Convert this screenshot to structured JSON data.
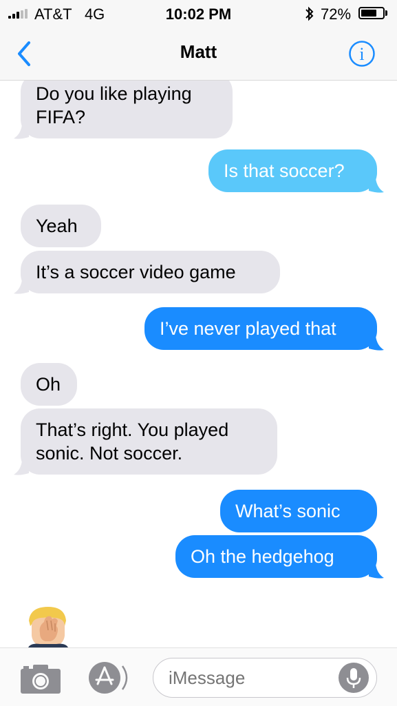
{
  "status_bar": {
    "carrier": "AT&T",
    "network": "4G",
    "time": "10:02 PM",
    "battery_percent": "72%",
    "battery_level": 0.72,
    "signal_bars_filled": 3,
    "signal_bars_total": 5,
    "icons": [
      "signal-icon",
      "bluetooth-icon",
      "battery-icon"
    ]
  },
  "nav": {
    "title": "Matt",
    "back_icon": "chevron-left-icon",
    "info_icon": "info-icon",
    "accent_color": "#1a8cff"
  },
  "messages": [
    {
      "direction": "incoming",
      "text_lines": [
        "Do you like playing",
        "FIFA?"
      ]
    },
    {
      "direction": "outgoing",
      "type": "sms",
      "text_lines": [
        "Is that soccer?"
      ]
    },
    {
      "direction": "incoming",
      "text_lines": [
        "Yeah"
      ]
    },
    {
      "direction": "incoming",
      "text_lines": [
        "It’s a soccer video game"
      ]
    },
    {
      "direction": "outgoing",
      "type": "imessage",
      "text_lines": [
        "I’ve never played that"
      ]
    },
    {
      "direction": "incoming",
      "text_lines": [
        "Oh"
      ]
    },
    {
      "direction": "incoming",
      "text_lines": [
        "That’s right. You played",
        "sonic. Not soccer."
      ]
    },
    {
      "direction": "outgoing",
      "type": "imessage",
      "text_lines": [
        "What’s sonic"
      ]
    },
    {
      "direction": "outgoing",
      "type": "imessage",
      "text_lines": [
        "Oh the hedgehog"
      ]
    }
  ],
  "sticker": {
    "name": "facepalm-memoji"
  },
  "composer": {
    "placeholder": "iMessage",
    "icons": [
      "camera-icon",
      "app-store-icon",
      "microphone-icon"
    ]
  },
  "colors": {
    "incoming_bubble": "#e6e5eb",
    "outgoing_sms_bubble": "#5ac8fa",
    "outgoing_imessage_bubble": "#1a8cff"
  }
}
